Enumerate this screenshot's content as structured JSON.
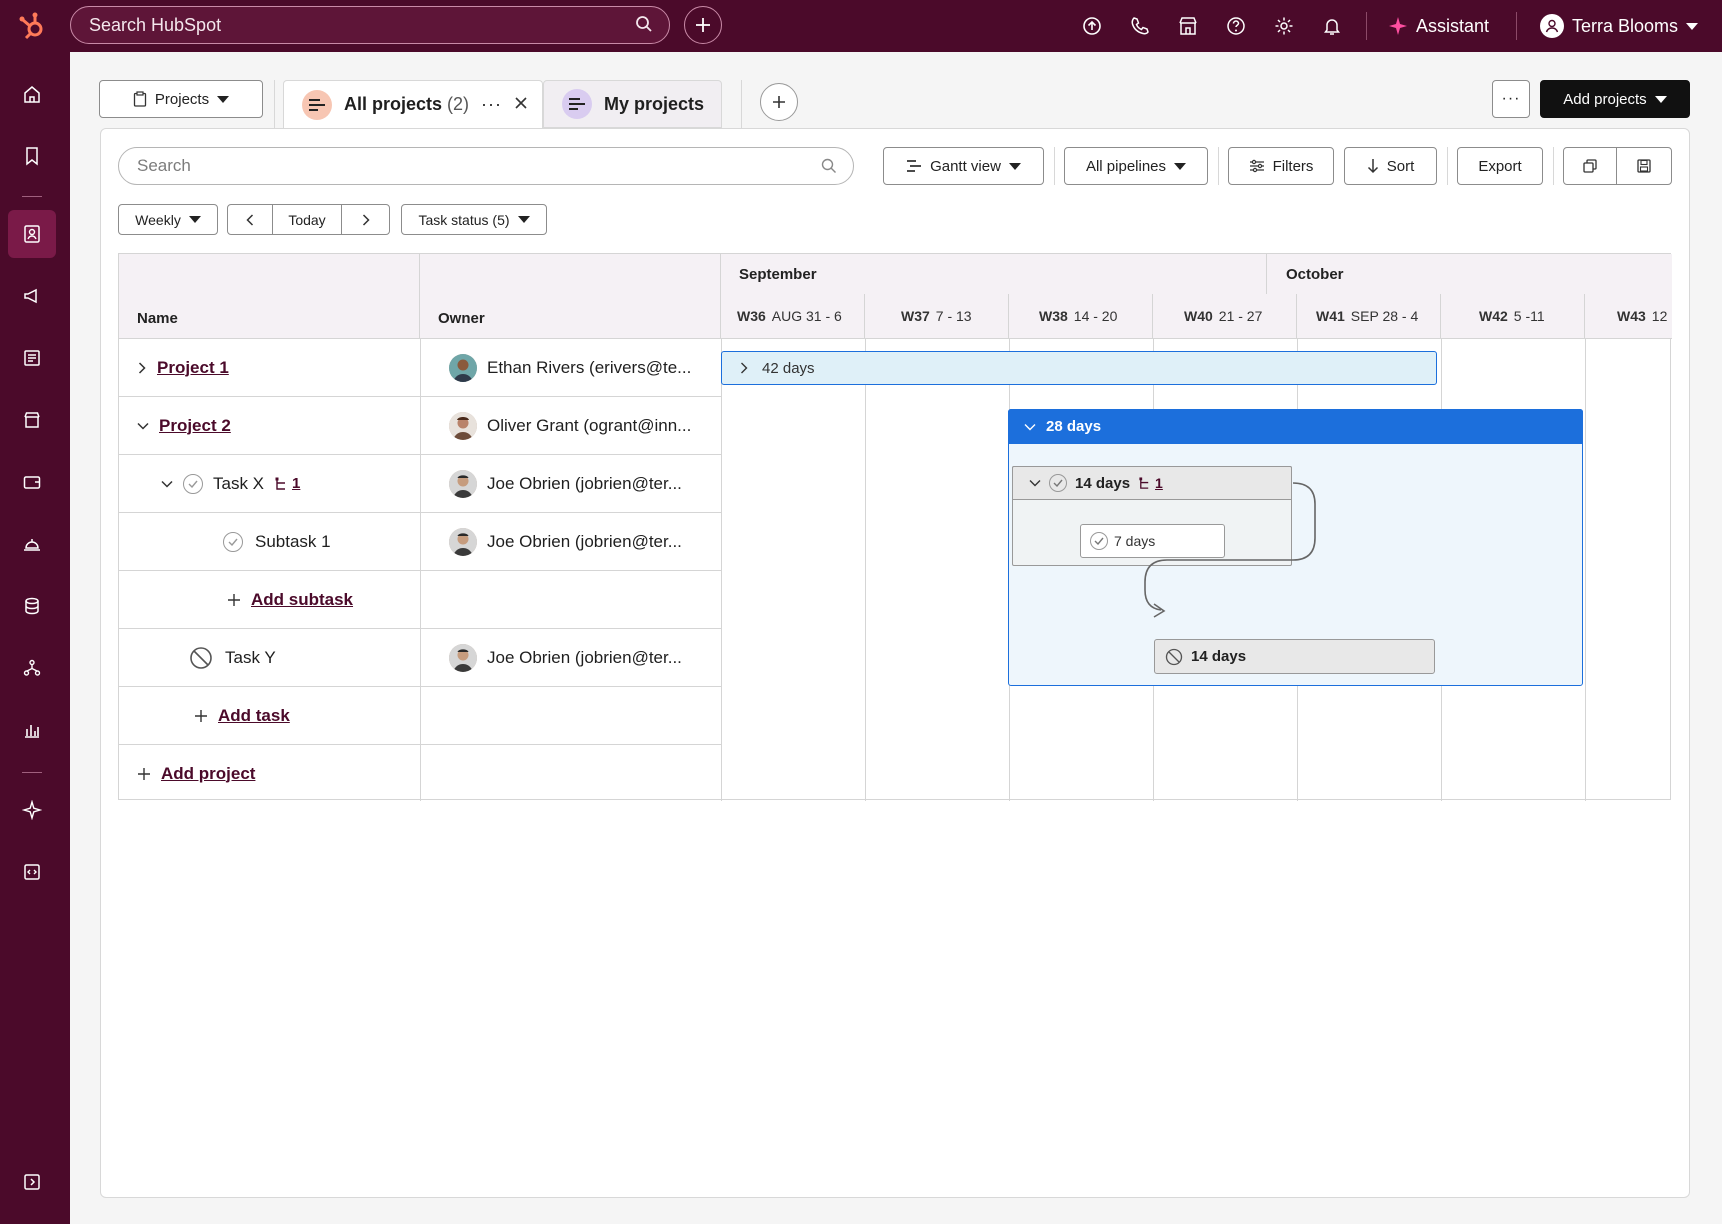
{
  "topbar": {
    "search_placeholder": "Search HubSpot",
    "assistant_label": "Assistant",
    "account_name": "Terra Blooms"
  },
  "toolbar": {
    "object_select": "Projects",
    "add_button": "Add projects"
  },
  "tabs": [
    {
      "label": "All projects",
      "count": "(2)"
    },
    {
      "label": "My projects"
    }
  ],
  "filters": {
    "search_placeholder": "Search",
    "view": "Gantt view",
    "pipelines": "All pipelines",
    "filters": "Filters",
    "sort": "Sort",
    "export": "Export",
    "period": "Weekly",
    "today": "Today",
    "task_status": "Task status (5)"
  },
  "table": {
    "col_name": "Name",
    "col_owner": "Owner",
    "rows": [
      {
        "name": "Project 1",
        "owner": "Ethan Rivers (erivers@te..."
      },
      {
        "name": "Project 2",
        "owner": "Oliver Grant (ogrant@inn..."
      },
      {
        "name": "Task X",
        "subcount": "1",
        "owner": "Joe Obrien (jobrien@ter..."
      },
      {
        "name": "Subtask 1",
        "owner": "Joe Obrien (jobrien@ter..."
      },
      {
        "name": "Add subtask"
      },
      {
        "name": "Task Y",
        "owner": "Joe Obrien (jobrien@ter..."
      },
      {
        "name": "Add task"
      },
      {
        "name": "Add project"
      }
    ]
  },
  "timeline": {
    "months": [
      "September",
      "October"
    ],
    "weeks": [
      {
        "code": "W36",
        "range": "AUG 31 - 6"
      },
      {
        "code": "W37",
        "range": "7 - 13"
      },
      {
        "code": "W38",
        "range": "14 - 20"
      },
      {
        "code": "W40",
        "range": "21 - 27"
      },
      {
        "code": "W41",
        "range": "SEP 28 - 4"
      },
      {
        "code": "W42",
        "range": "5 -11"
      },
      {
        "code": "W43",
        "range": "12"
      }
    ],
    "bars": {
      "project1": "42 days",
      "project2": "28 days",
      "taskx": "14 days",
      "taskx_count": "1",
      "subtask1": "7 days",
      "tasky": "14 days"
    }
  },
  "colors": {
    "brand": "#4b0a2a",
    "accent_blue": "#1c6fdc",
    "project_bar_bg": "#dff0f8",
    "project_bar_border": "#1c6fdc"
  }
}
